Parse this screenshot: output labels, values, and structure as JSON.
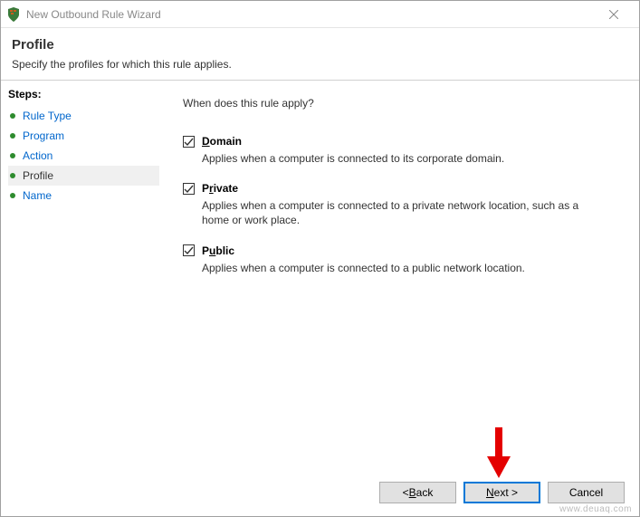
{
  "window": {
    "title": "New Outbound Rule Wizard"
  },
  "header": {
    "title": "Profile",
    "subtitle": "Specify the profiles for which this rule applies."
  },
  "steps": {
    "title": "Steps:",
    "items": [
      {
        "label": "Rule Type",
        "current": false
      },
      {
        "label": "Program",
        "current": false
      },
      {
        "label": "Action",
        "current": false
      },
      {
        "label": "Profile",
        "current": true
      },
      {
        "label": "Name",
        "current": false
      }
    ]
  },
  "content": {
    "question": "When does this rule apply?",
    "options": [
      {
        "key": "domain",
        "label_pre": "",
        "label_ul": "D",
        "label_post": "omain",
        "checked": true,
        "desc": "Applies when a computer is connected to its corporate domain."
      },
      {
        "key": "private",
        "label_pre": "P",
        "label_ul": "r",
        "label_post": "ivate",
        "checked": true,
        "desc": "Applies when a computer is connected to a private network location, such as a home or work place."
      },
      {
        "key": "public",
        "label_pre": "P",
        "label_ul": "u",
        "label_post": "blic",
        "checked": true,
        "desc": "Applies when a computer is connected to a public network location."
      }
    ]
  },
  "buttons": {
    "back_pre": "< ",
    "back_ul": "B",
    "back_post": "ack",
    "next_ul": "N",
    "next_post": "ext >",
    "cancel": "Cancel"
  },
  "watermark": "www.deuaq.com"
}
